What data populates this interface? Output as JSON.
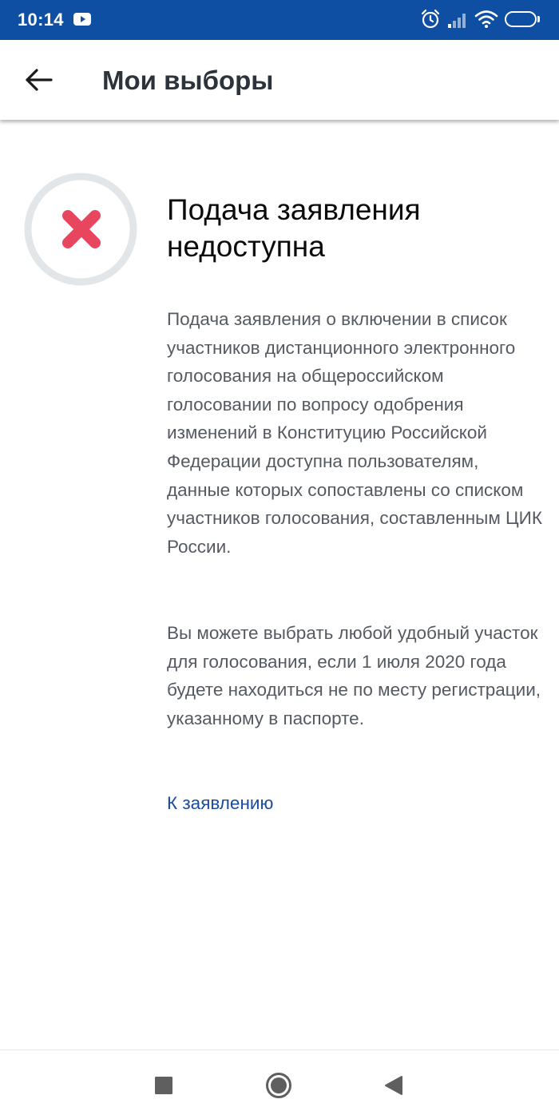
{
  "status_bar": {
    "time": "10:14",
    "battery": "50",
    "icons": [
      "youtube-icon",
      "alarm-icon",
      "signal-icon",
      "wifi-icon",
      "battery-icon"
    ]
  },
  "app_bar": {
    "title": "Мои выборы",
    "back_icon": "arrow-left-icon"
  },
  "status": {
    "icon": "close-x-icon",
    "accent_color": "#e8465f",
    "ring_color": "#e3e6e8"
  },
  "content": {
    "heading": "Подача заявления недоступна",
    "paragraph_1": "Подача заявления о включении в список участников дистанционного электронного голосования на общероссийском голосовании по вопросу одобрения изменений в Конституцию Российской Федерации доступна пользователям, данные которых сопоставлены со списком участников голосования, составленным ЦИК России.",
    "paragraph_2": "Вы можете выбрать любой удобный участок для голосования, если 1 июля 2020 года будете находиться не по месту регистрации, указанному в паспорте.",
    "link_label": "К заявлению",
    "link_color": "#1a4b9e"
  },
  "nav_bar": {
    "icons": [
      "square-recents-icon",
      "circle-home-icon",
      "triangle-back-icon"
    ]
  },
  "colors": {
    "status_bar_bg": "#0e4ea3",
    "title_text": "#2d333b",
    "body_text": "#555a61"
  }
}
